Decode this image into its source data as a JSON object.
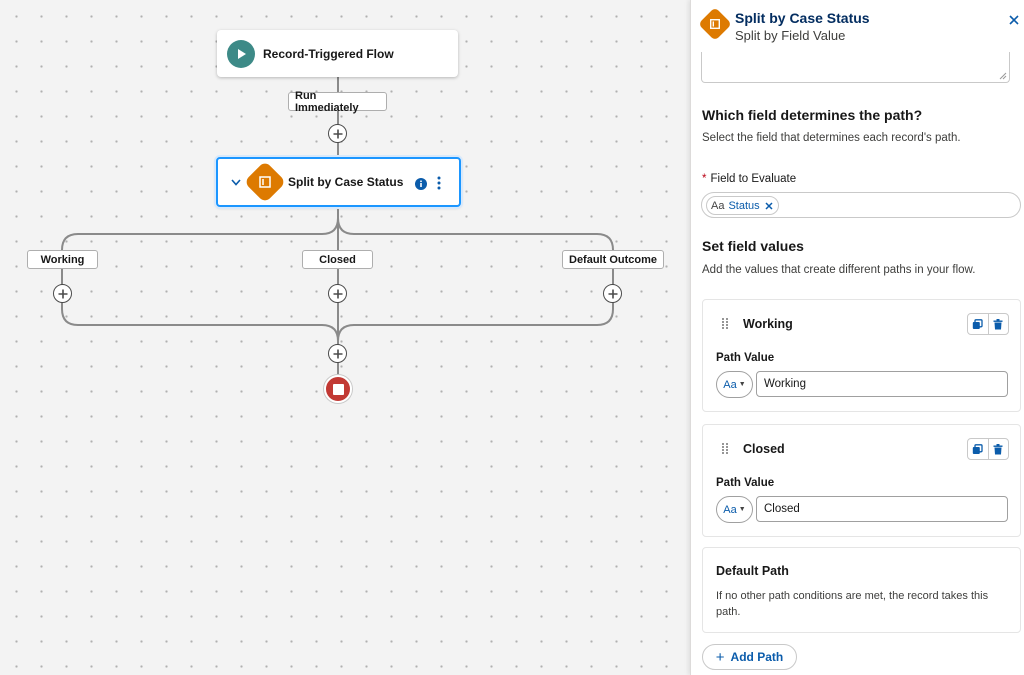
{
  "flow": {
    "start_title": "Record-Triggered Flow",
    "run_label": "Run Immediately",
    "decision_title": "Split by Case Status",
    "outcomes": [
      "Working",
      "Closed",
      "Default Outcome"
    ]
  },
  "panel": {
    "title": "Split by Case Status",
    "subtitle": "Split by Field Value",
    "field_section": {
      "title": "Which field determines the path?",
      "help": "Select the field that determines each record's path."
    },
    "field_to_evaluate": {
      "label": "Field to Evaluate",
      "required_marker": "*",
      "type_glyph": "Aa",
      "value": "Status"
    },
    "values_section": {
      "title": "Set field values",
      "help": "Add the values that create different paths in your flow."
    },
    "paths": [
      {
        "title": "Working",
        "value_label": "Path Value",
        "type_glyph": "Aa",
        "value": "Working"
      },
      {
        "title": "Closed",
        "value_label": "Path Value",
        "type_glyph": "Aa",
        "value": "Closed"
      }
    ],
    "default_path": {
      "title": "Default Path",
      "description": "If no other path conditions are met, the record takes this path."
    },
    "add_path_label": "Add Path"
  },
  "colors": {
    "start_icon": "#3d8a87",
    "decision_icon": "#dd7a01",
    "end_node": "#c23934",
    "selection_border": "#1b96ff",
    "brand_text": "#0b5cab"
  },
  "icons": [
    "play-icon",
    "chevron-down-icon",
    "decision-icon",
    "info-icon",
    "more-vertical-icon",
    "plus-icon",
    "stop-icon",
    "close-icon",
    "drag-handle-icon",
    "copy-icon",
    "delete-icon",
    "text-type-icon"
  ]
}
